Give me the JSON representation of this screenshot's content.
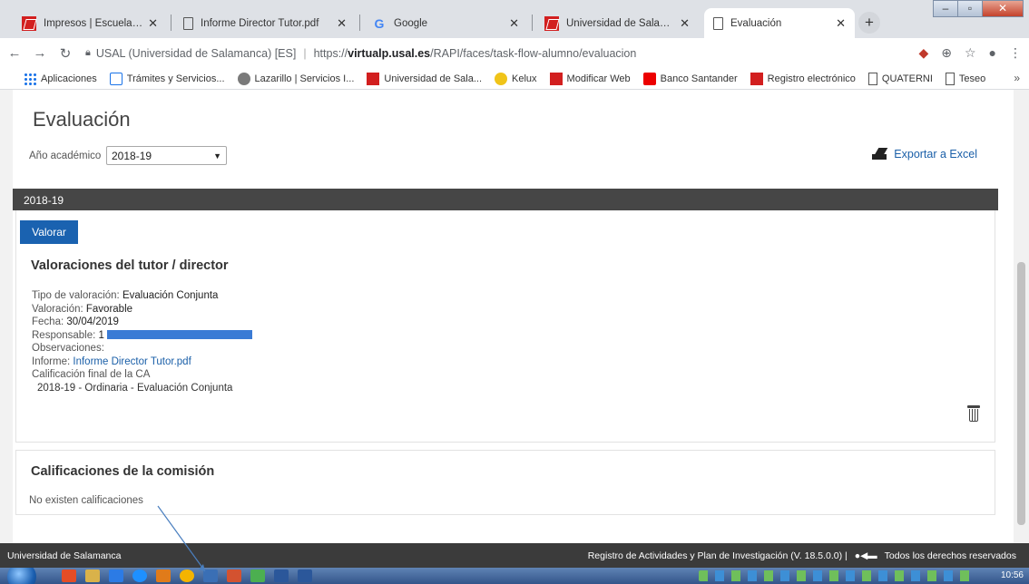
{
  "tabs": [
    {
      "title": "Impresos | Escuela de Docto",
      "favicon": "usal-icon"
    },
    {
      "title": "Informe Director Tutor.pdf",
      "favicon": "document-icon"
    },
    {
      "title": "Google",
      "favicon": "google-icon"
    },
    {
      "title": "Universidad de Salamanca |",
      "favicon": "usal-icon"
    },
    {
      "title": "Evaluación",
      "favicon": "document-icon",
      "active": true
    }
  ],
  "toolbar": {
    "site_info": "USAL (Universidad de Salamanca) [ES]",
    "url_prefix": "https://",
    "url_host": "virtualp.usal.es",
    "url_path": "/RAPI/faces/task-flow-alumno/evaluacion"
  },
  "bookmarks": [
    {
      "label": "Aplicaciones",
      "icon": "apps-grid-icon"
    },
    {
      "label": "Trámites y Servicios...",
      "icon": "tramites-icon"
    },
    {
      "label": "Lazarillo | Servicios I...",
      "icon": "lazarillo-icon"
    },
    {
      "label": "Universidad de Sala...",
      "icon": "usal-icon"
    },
    {
      "label": "Kelux",
      "icon": "kelux-icon"
    },
    {
      "label": "Modificar Web",
      "icon": "usal-icon"
    },
    {
      "label": "Banco Santander",
      "icon": "santander-icon"
    },
    {
      "label": "Registro electrónico",
      "icon": "usal-icon"
    },
    {
      "label": "QUATERNI",
      "icon": "document-icon"
    },
    {
      "label": "Teseo",
      "icon": "document-icon"
    }
  ],
  "page": {
    "title": "Evaluación",
    "year_label": "Año académico",
    "year_value": "2018-19",
    "export_label": "Exportar a Excel",
    "year_bar": "2018-19",
    "valorar_label": "Valorar",
    "section1_title": "Valoraciones del tutor / director",
    "details": {
      "tipo_label": "Tipo de valoración:",
      "tipo_value": "Evaluación Conjunta",
      "valoracion_label": "Valoración:",
      "valoracion_value": "Favorable",
      "fecha_label": "Fecha:",
      "fecha_value": "30/04/2019",
      "responsable_label": "Responsable:",
      "responsable_value": "1",
      "observaciones_label": "Observaciones:",
      "informe_label": "Informe:",
      "informe_value": "Informe Director Tutor.pdf",
      "calificacion_label": "Calificación final de la CA",
      "calificacion_value": "2018-19 - Ordinaria - Evaluación Conjunta"
    },
    "section2_title": "Calificaciones de la comisión",
    "no_calificaciones": "No existen calificaciones"
  },
  "footer": {
    "left": "Universidad de Salamanca",
    "right": "Registro de Actividades y Plan de Investigación (V. 18.5.0.0) |",
    "rights": "Todos los derechos reservados"
  },
  "taskbar": {
    "clock": "10:56"
  }
}
